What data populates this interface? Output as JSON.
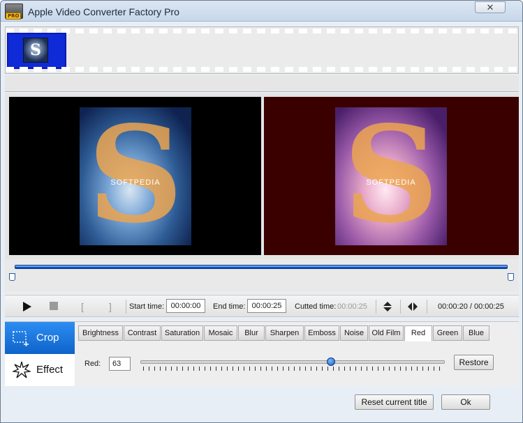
{
  "window": {
    "title": "Apple Video Converter Factory Pro",
    "close_glyph": "✕",
    "icon_badge": "PRO"
  },
  "filmstrip": {
    "thumbnail_letter": "S"
  },
  "preview": {
    "left_letter": "S",
    "right_letter": "S",
    "watermark": "SOFTPEDIA"
  },
  "timeline": {
    "progress_fraction": 1.0
  },
  "controls": {
    "mark_in": "[",
    "mark_out": "]",
    "start_label": "Start time:",
    "start_value": "00:00:00",
    "end_label": "End time:",
    "end_value": "00:00:25",
    "cut_label": "Cutted time:",
    "cut_value": "00:00:25",
    "total": "00:00:20 / 00:00:25"
  },
  "sidebar": {
    "crop_label": "Crop",
    "effect_label": "Effect"
  },
  "tabs": [
    "Brightness",
    "Contrast",
    "Saturation",
    "Mosaic",
    "Blur",
    "Sharpen",
    "Emboss",
    "Noise",
    "Old Film",
    "Red",
    "Green",
    "Blue"
  ],
  "active_tab": "Red",
  "adjust": {
    "label": "Red:",
    "value": "63",
    "slider_fraction": 0.625,
    "restore_label": "Restore"
  },
  "footer": {
    "reset_label": "Reset current title",
    "ok_label": "Ok"
  },
  "colors": {
    "accent": "#0e63c9",
    "track": "#0e4fb5"
  }
}
